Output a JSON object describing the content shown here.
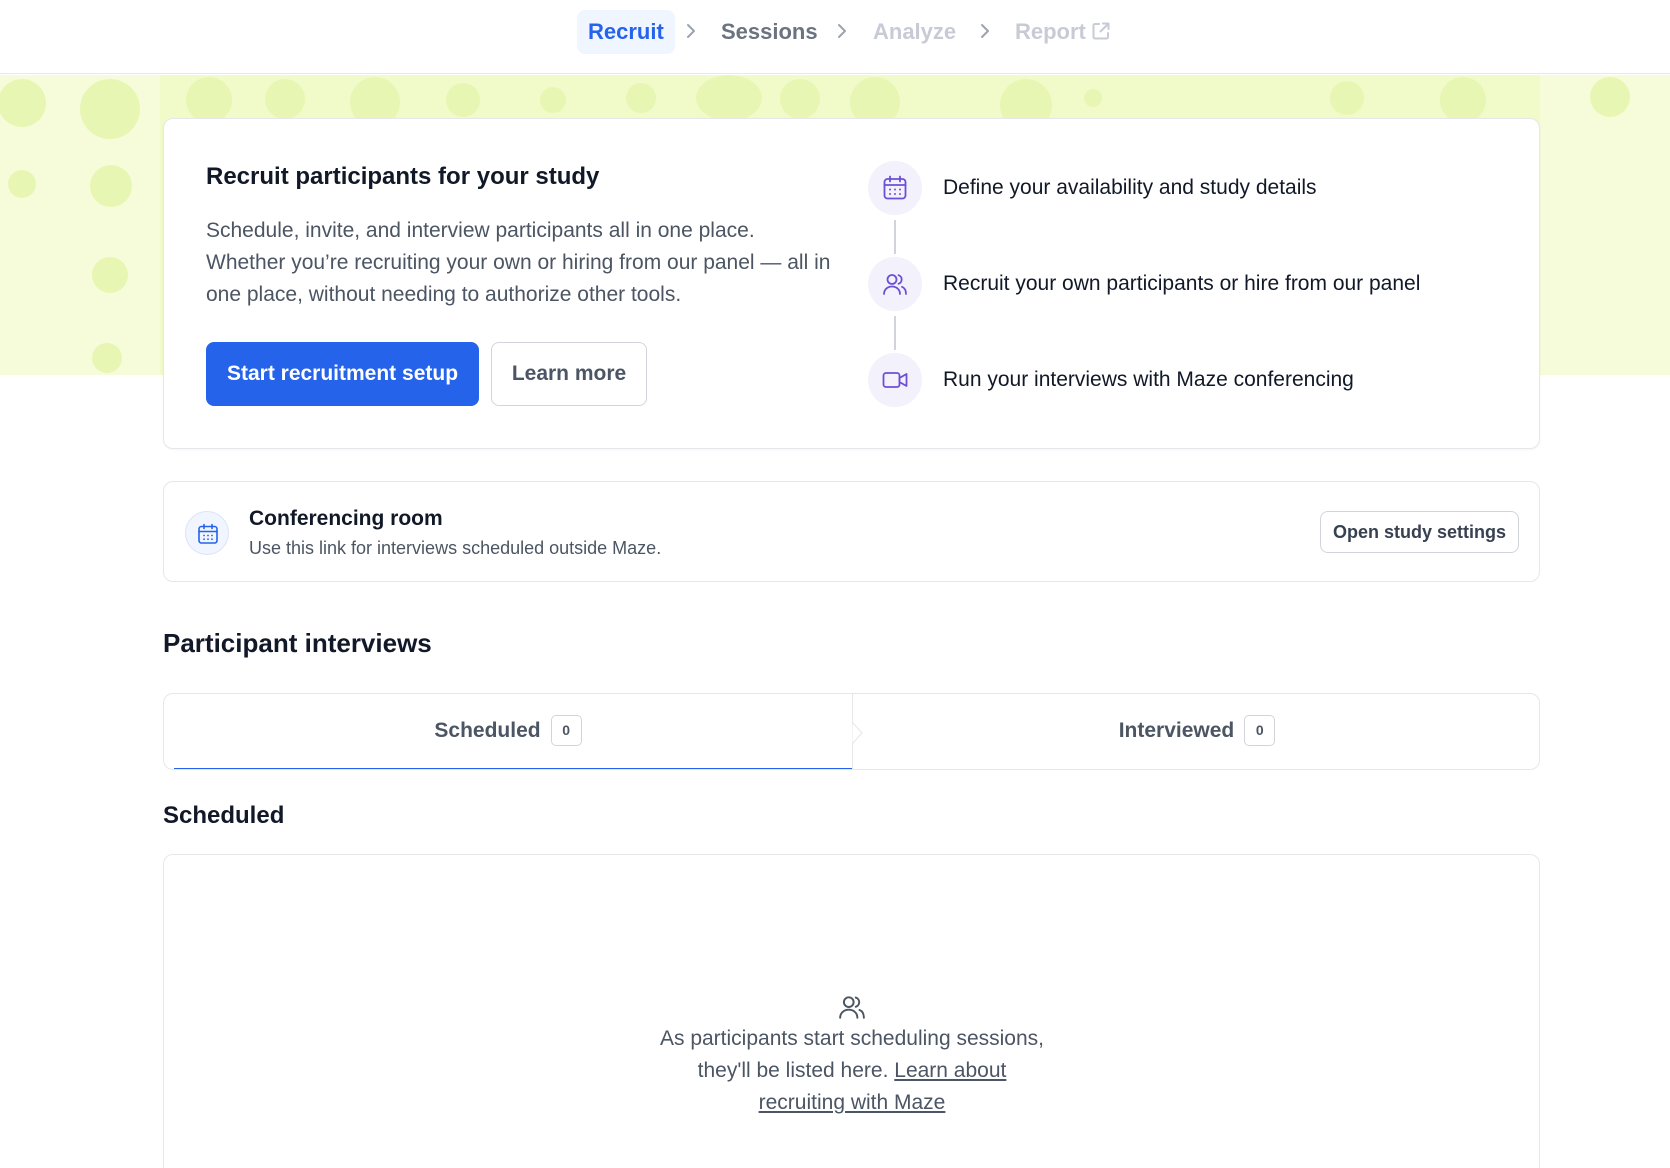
{
  "nav": {
    "steps": [
      {
        "label": "Recruit",
        "state": "active"
      },
      {
        "label": "Sessions",
        "state": "default"
      },
      {
        "label": "Analyze",
        "state": "disabled"
      },
      {
        "label": "Report",
        "state": "disabled"
      }
    ]
  },
  "hero": {
    "title": "Recruit participants for your study",
    "description": "Schedule, invite, and interview participants all in one place. Whether you’re recruiting your own or hiring from our panel — all in one place, without needing to authorize other tools.",
    "primary_button": "Start recruitment setup",
    "secondary_button": "Learn more",
    "steps": [
      {
        "icon": "calendar-icon",
        "label": "Define your availability and study details"
      },
      {
        "icon": "users-icon",
        "label": "Recruit your own participants or hire from our panel"
      },
      {
        "icon": "video-icon",
        "label": "Run your interviews with Maze conferencing"
      }
    ]
  },
  "conferencing": {
    "title": "Conferencing room",
    "subtitle": "Use this link for interviews scheduled outside Maze.",
    "button": "Open study settings"
  },
  "interviews": {
    "title": "Participant interviews",
    "tabs": [
      {
        "label": "Scheduled",
        "count": "0",
        "active": true
      },
      {
        "label": "Interviewed",
        "count": "0",
        "active": false
      }
    ],
    "list_title": "Scheduled",
    "empty_text": "As participants start scheduling sessions, they'll be listed here.",
    "empty_link": "Learn about recruiting with Maze"
  },
  "colors": {
    "primary": "#2563eb",
    "hero_backdrop": "#f1fbc9",
    "icon_accent": "#6d4fd6"
  }
}
